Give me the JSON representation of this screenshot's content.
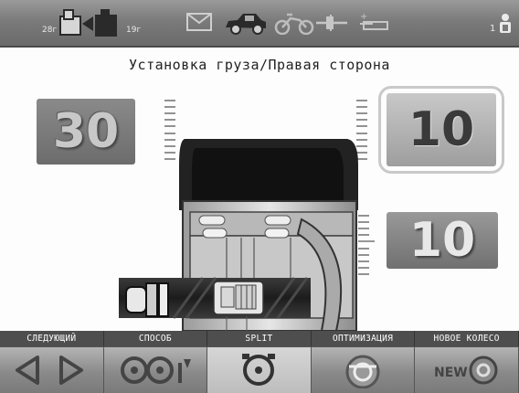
{
  "topbar": {
    "left_size": "28г",
    "right_size": "19г",
    "user_number": "1"
  },
  "title": "Установка груза/Правая сторона",
  "weights": {
    "left": "30",
    "right_top": "10",
    "right_bottom": "10"
  },
  "menu": {
    "labels": [
      "СЛЕДУЮЩИЙ",
      "СПОСОБ",
      "SPLIT",
      "ОПТИМИЗАЦИЯ",
      "НОВОЕ КОЛЕСО"
    ],
    "new_badge": "NEW"
  },
  "colors": {
    "topbar": "#7b7b7b",
    "menu_bar": "#4e4e4e",
    "tread_stripe": "#d9d9d9"
  }
}
